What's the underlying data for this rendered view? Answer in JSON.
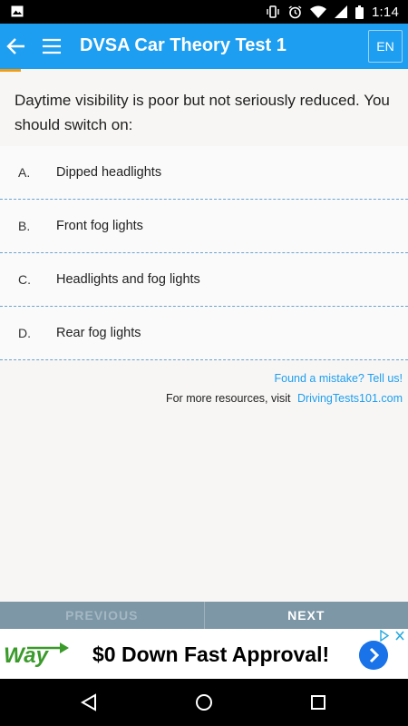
{
  "status_bar": {
    "time": "1:14",
    "icons": [
      "image-icon",
      "vibrate-icon",
      "alarm-icon",
      "wifi-icon",
      "signal-icon",
      "battery-icon"
    ]
  },
  "app_bar": {
    "title": "DVSA Car Theory Test 1",
    "language": "EN",
    "color": "#1e9ef0"
  },
  "progress": {
    "fraction": 0.05,
    "color": "#f39c12"
  },
  "question": {
    "text": "Daytime visibility is poor but not seriously reduced. You should switch on:",
    "answers": [
      {
        "letter": "A.",
        "text": "Dipped headlights"
      },
      {
        "letter": "B.",
        "text": "Front fog lights"
      },
      {
        "letter": "C.",
        "text": "Headlights and fog lights"
      },
      {
        "letter": "D.",
        "text": "Rear fog lights"
      }
    ]
  },
  "links": {
    "report": "Found a mistake? Tell us!",
    "resources_prefix": "For more resources, visit",
    "resources_site": "DrivingTests101.com"
  },
  "navigation": {
    "previous": "PREVIOUS",
    "next": "NEXT"
  },
  "ad": {
    "logo": "Way",
    "headline": "$0 Down Fast Approval!"
  }
}
